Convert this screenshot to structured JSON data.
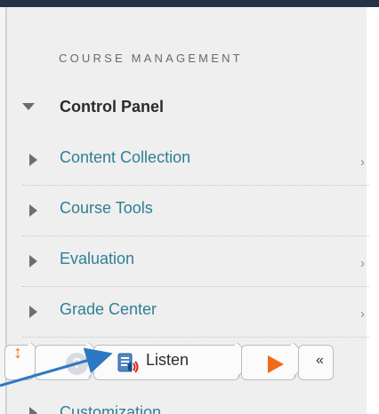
{
  "panel": {
    "section_title": "COURSE MANAGEMENT",
    "control_panel_label": "Control Panel",
    "items": [
      {
        "label": "Content Collection",
        "has_chevron": true
      },
      {
        "label": "Course Tools",
        "has_chevron": false
      },
      {
        "label": "Evaluation",
        "has_chevron": true
      },
      {
        "label": "Grade Center",
        "has_chevron": true
      },
      {
        "label": "Customization",
        "has_chevron": false
      }
    ],
    "chevron_glyph": "›"
  },
  "toolbar": {
    "updown_glyph": "↕",
    "help_glyph": "?",
    "listen_label": "Listen",
    "collapse_glyph": "«",
    "colors": {
      "orange": "#f07b12",
      "blue_arrow": "#2d78c4"
    }
  }
}
